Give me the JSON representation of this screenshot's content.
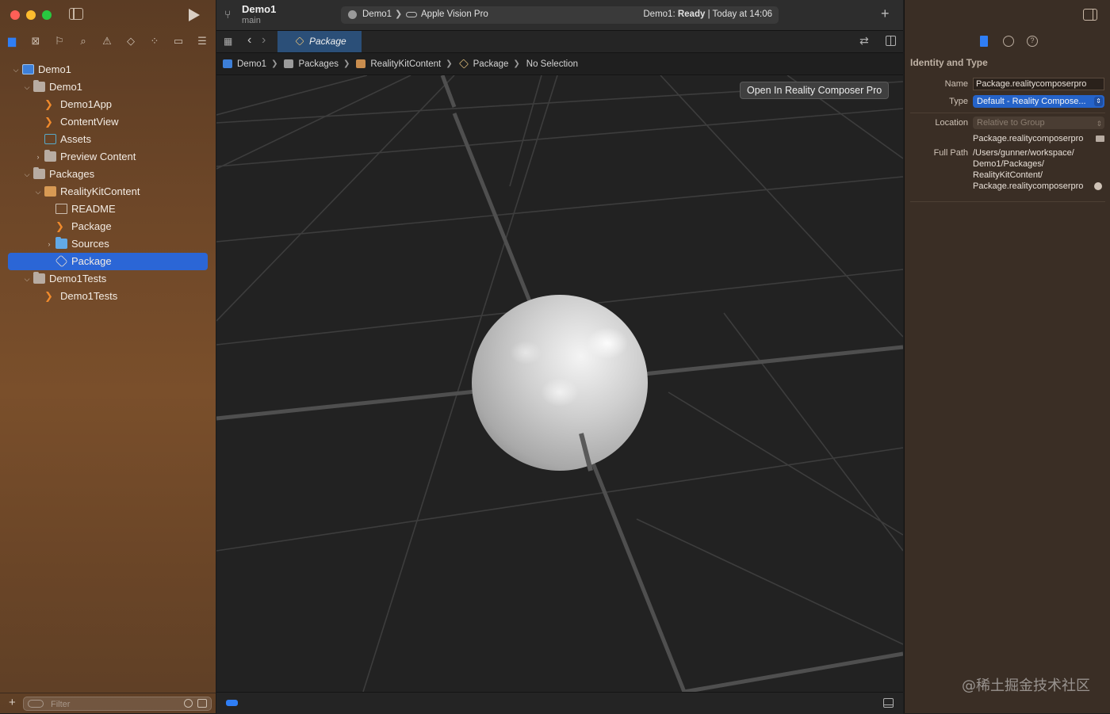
{
  "toolbar": {
    "project": "Demo1",
    "branch": "main",
    "scheme_project": "Demo1",
    "scheme_device": "Apple Vision Pro",
    "status_prefix": "Demo1: ",
    "status_state": "Ready",
    "status_suffix": " | Today at 14:06"
  },
  "navigator": {
    "tree": [
      {
        "label": "Demo1",
        "icon": "project-icon",
        "depth": 0,
        "chevron": "open"
      },
      {
        "label": "Demo1",
        "icon": "folder-icon",
        "depth": 1,
        "chevron": "open"
      },
      {
        "label": "Demo1App",
        "icon": "swift-file-icon",
        "depth": 2,
        "chevron": ""
      },
      {
        "label": "ContentView",
        "icon": "swift-file-icon",
        "depth": 2,
        "chevron": ""
      },
      {
        "label": "Assets",
        "icon": "asset-catalog-icon",
        "depth": 2,
        "chevron": ""
      },
      {
        "label": "Preview Content",
        "icon": "folder-icon",
        "depth": 2,
        "chevron": "closed"
      },
      {
        "label": "Packages",
        "icon": "folder-icon",
        "depth": 1,
        "chevron": "open"
      },
      {
        "label": "RealityKitContent",
        "icon": "package-icon",
        "depth": 2,
        "chevron": "open"
      },
      {
        "label": "README",
        "icon": "book-icon",
        "depth": 3,
        "chevron": ""
      },
      {
        "label": "Package",
        "icon": "swift-file-icon",
        "depth": 3,
        "chevron": ""
      },
      {
        "label": "Sources",
        "icon": "blue-folder-icon",
        "depth": 3,
        "chevron": "closed"
      },
      {
        "label": "Package",
        "icon": "reality-composer-icon",
        "depth": 3,
        "chevron": "",
        "selected": true
      },
      {
        "label": "Demo1Tests",
        "icon": "folder-icon",
        "depth": 1,
        "chevron": "open"
      },
      {
        "label": "Demo1Tests",
        "icon": "swift-file-icon",
        "depth": 2,
        "chevron": ""
      }
    ],
    "filter_placeholder": "Filter"
  },
  "tab": {
    "label": "Package"
  },
  "jumpbar": [
    {
      "label": "Demo1",
      "icon": "project-icon"
    },
    {
      "label": "Packages",
      "icon": "folder-icon"
    },
    {
      "label": "RealityKitContent",
      "icon": "package-icon"
    },
    {
      "label": "Package",
      "icon": "reality-composer-icon"
    },
    {
      "label": "No Selection",
      "icon": ""
    }
  ],
  "viewport": {
    "open_button": "Open In Reality Composer Pro"
  },
  "inspector": {
    "section": "Identity and Type",
    "name_label": "Name",
    "name_value": "Package.realitycomposerpro",
    "type_label": "Type",
    "type_value": "Default - Reality Compose...",
    "location_label": "Location",
    "location_value": "Relative to Group",
    "location_file": "Package.realitycomposerpro",
    "full_path_label": "Full Path",
    "full_path_lines": [
      "/Users/gunner/workspace/",
      "Demo1/Packages/",
      "RealityKitContent/",
      "Package.realitycomposerpro"
    ]
  },
  "watermark": "@稀土掘金技术社区",
  "colors": {
    "accent": "#2b66d6",
    "sidebar_bg": "#6e4728",
    "viewport_bg": "#222222"
  }
}
